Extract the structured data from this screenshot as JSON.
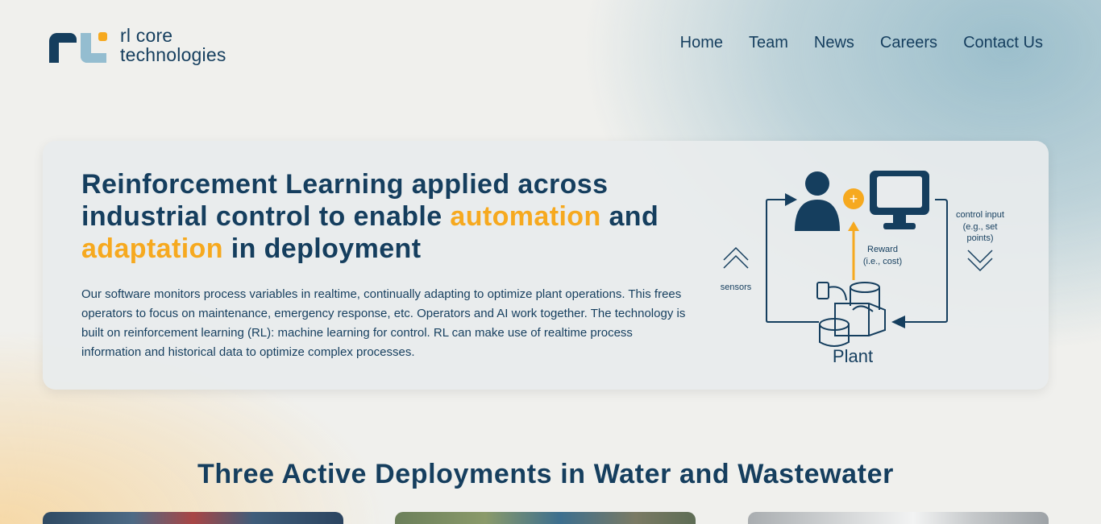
{
  "logo": {
    "line1": "rl core",
    "line2": "technologies"
  },
  "nav": [
    {
      "label": "Home"
    },
    {
      "label": "Team"
    },
    {
      "label": "News"
    },
    {
      "label": "Careers"
    },
    {
      "label": "Contact Us"
    }
  ],
  "hero": {
    "title_bold": "Reinforcement Learning",
    "title_part1": " applied across industrial control to enable ",
    "title_accent1": "automation",
    "title_part2": " and ",
    "title_accent2": "adaptation",
    "title_part3": " in deployment",
    "body": "Our software monitors process variables in realtime, continually adapting to optimize plant operations. This frees operators to focus on maintenance, emergency response, etc. Operators and AI work together. The technology is built on reinforcement learning (RL): machine learning for control. RL can make use of realtime process information and historical data to optimize complex processes."
  },
  "diagram": {
    "sensors_label": "sensors",
    "reward_line1": "Reward",
    "reward_line2": "(i.e., cost)",
    "control_line1": "control input",
    "control_line2": "(e.g., set",
    "control_line3": "points)",
    "plant_label": "Plant",
    "plus_symbol": "+",
    "colors": {
      "primary": "#153e5e",
      "accent": "#f6a91f"
    }
  },
  "section": {
    "title": "Three Active Deployments in Water and Wastewater"
  },
  "colors": {
    "brand": "#153e5e",
    "accent": "#f6a91f",
    "light": "#94bdd0"
  }
}
